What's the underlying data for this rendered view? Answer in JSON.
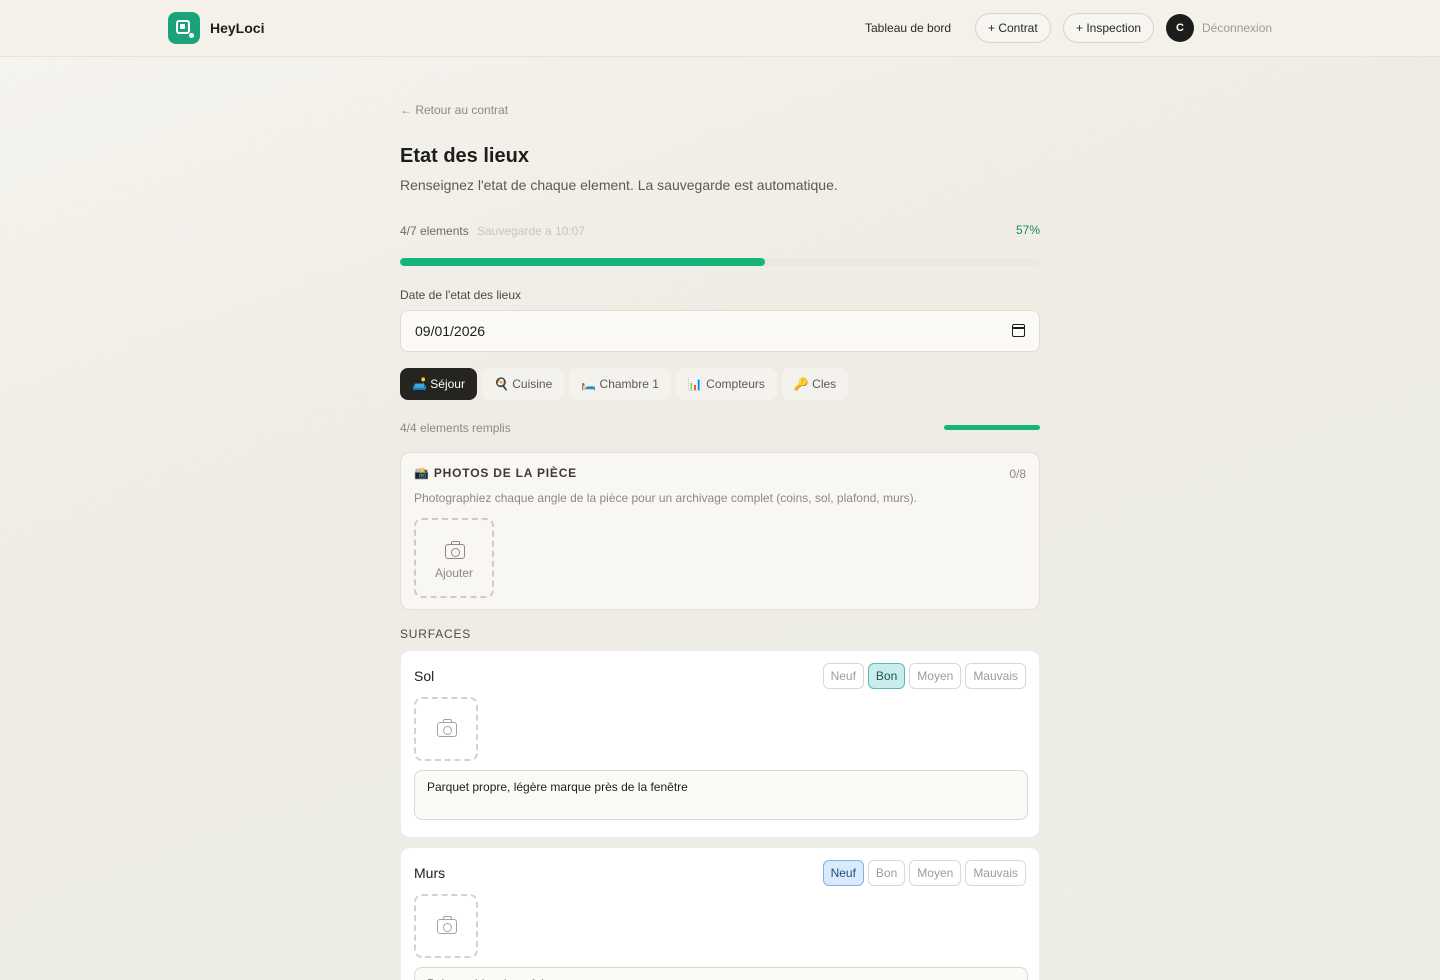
{
  "header": {
    "brand": "HeyLoci",
    "nav_dashboard": "Tableau de bord",
    "btn_contract": "+ Contrat",
    "btn_inspection": "+ Inspection",
    "avatar_initial": "C",
    "logout": "Déconnexion"
  },
  "page": {
    "back_link": "← Retour au contrat",
    "title": "Etat des lieux",
    "subtitle": "Renseignez l'etat de chaque element. La sauvegarde est automatique.",
    "elements_count": "4/7 elements",
    "saved_status": "Sauvegarde a 10:07",
    "percent_label": "57%",
    "progress": 0.57
  },
  "date_field": {
    "label": "Date de l'etat des lieux",
    "value": "09/01/2026"
  },
  "tabs": [
    {
      "label": "🛋️ Séjour",
      "active": true
    },
    {
      "label": "🍳 Cuisine",
      "active": false
    },
    {
      "label": "🛏️ Chambre 1",
      "active": false
    },
    {
      "label": "📊 Compteurs",
      "active": false
    },
    {
      "label": "🔑 Cles",
      "active": false
    }
  ],
  "room": {
    "filled_count": "4/4 elements remplis",
    "progress": 1.0
  },
  "photos": {
    "title": "📸 PHOTOS DE LA PIÈCE",
    "count": "0/8",
    "description": "Photographiez chaque angle de la pièce pour un archivage complet (coins, sol, plafond, murs).",
    "add_label": "Ajouter"
  },
  "section_surfaces": "SURFACES",
  "states": [
    "Neuf",
    "Bon",
    "Moyen",
    "Mauvais"
  ],
  "elements": [
    {
      "name": "Sol",
      "selected": "Bon",
      "note": "Parquet propre, légère marque près de la fenêtre"
    },
    {
      "name": "Murs",
      "selected": "Neuf",
      "note": "Peinture blanche refaite"
    }
  ],
  "colors": {
    "accent": "#16b37a",
    "brand": "#1aa37a",
    "dark": "#262420",
    "bon_bg": "#c9ecec",
    "neuf_bg": "#d9eafb"
  }
}
